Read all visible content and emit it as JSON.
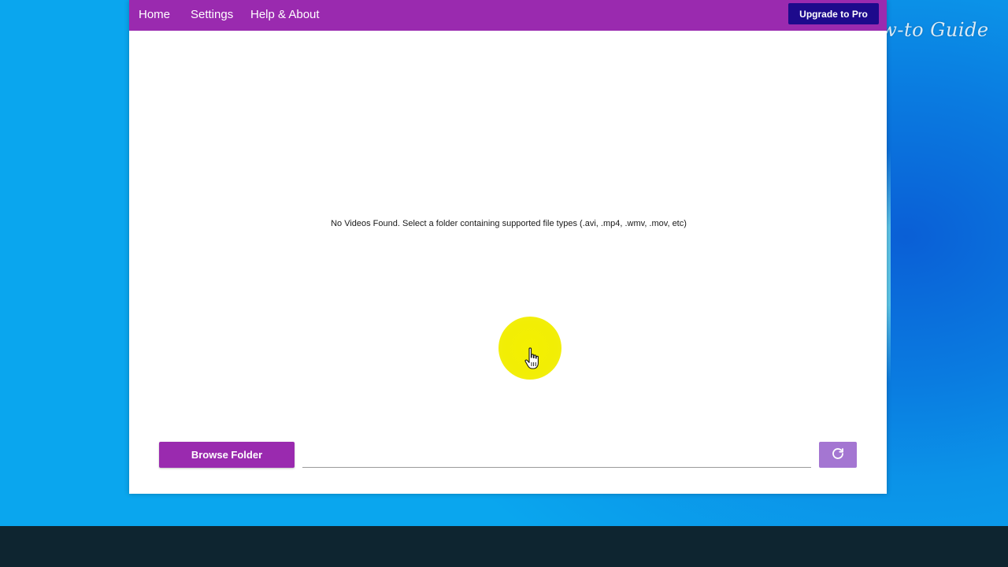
{
  "nav": {
    "home": "Home",
    "settings": "Settings",
    "help": "Help & About"
  },
  "header": {
    "upgrade_label": "Upgrade to Pro"
  },
  "main": {
    "empty_message": "No Videos Found. Select a folder containing supported file types (.avi, .mp4, .wmv, .mov, etc)"
  },
  "footer": {
    "browse_label": "Browse Folder",
    "path_value": "",
    "refresh_icon": "refresh-icon"
  },
  "watermark": {
    "text": "How-to Guide"
  },
  "colors": {
    "accent": "#9a2aaf",
    "upgrade": "#1d0a8c",
    "refresh": "#a476d2",
    "cursor_highlight": "#f4f000"
  }
}
